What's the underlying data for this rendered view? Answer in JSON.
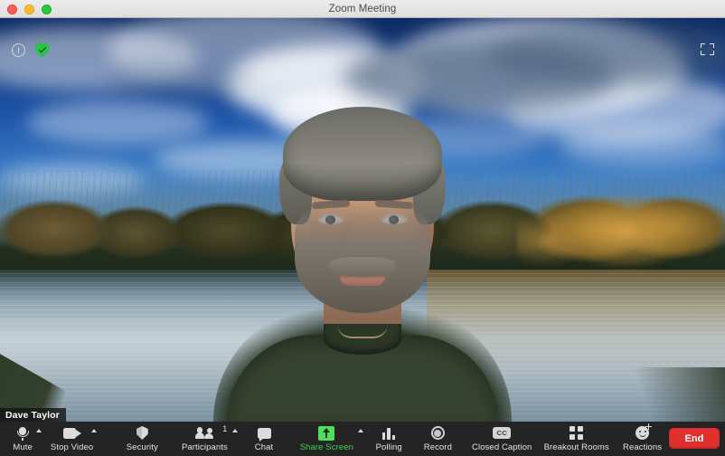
{
  "window": {
    "title": "Zoom Meeting",
    "traffic_lights": [
      "close",
      "minimize",
      "zoom"
    ]
  },
  "overlay": {
    "info_icon": "info-circle-icon",
    "encryption_icon": "green-shield-check-icon",
    "fullscreen_icon": "enter-fullscreen-icon",
    "participant_name": "Dave Taylor"
  },
  "video": {
    "background_scene": "lake with autumn trees and blue cloudy sky",
    "self_view_label": "Dave Taylor"
  },
  "toolbar": {
    "items": [
      {
        "label": "Mute",
        "icon": "microphone-icon",
        "chevron": true,
        "badge": "",
        "accent": ""
      },
      {
        "label": "Stop Video",
        "icon": "video-camera-icon",
        "chevron": true,
        "badge": "",
        "accent": ""
      },
      {
        "label": "Security",
        "icon": "shield-icon",
        "chevron": false,
        "badge": "",
        "accent": ""
      },
      {
        "label": "Participants",
        "icon": "people-icon",
        "chevron": true,
        "badge": "1",
        "accent": ""
      },
      {
        "label": "Chat",
        "icon": "chat-bubble-icon",
        "chevron": false,
        "badge": "",
        "accent": ""
      },
      {
        "label": "Share Screen",
        "icon": "share-screen-icon",
        "chevron": true,
        "badge": "",
        "accent": "#3ed44f"
      },
      {
        "label": "Polling",
        "icon": "bar-chart-icon",
        "chevron": false,
        "badge": "",
        "accent": ""
      },
      {
        "label": "Record",
        "icon": "record-circle-icon",
        "chevron": false,
        "badge": "",
        "accent": ""
      },
      {
        "label": "Closed Caption",
        "icon": "cc-icon",
        "chevron": false,
        "badge": "",
        "accent": ""
      },
      {
        "label": "Breakout Rooms",
        "icon": "grid-four-icon",
        "chevron": false,
        "badge": "",
        "accent": ""
      },
      {
        "label": "Reactions",
        "icon": "smiley-plus-icon",
        "chevron": false,
        "badge": "",
        "accent": ""
      }
    ],
    "cc_badge_text": "CC",
    "end_button": "End"
  },
  "colors": {
    "titlebar_bg": "#e8e8e8",
    "toolbar_bg": "#242424",
    "share_green": "#4ede57",
    "end_red": "#e02f2f",
    "shield_green": "#2bc24a",
    "icon_gray": "#dcdcdc"
  }
}
